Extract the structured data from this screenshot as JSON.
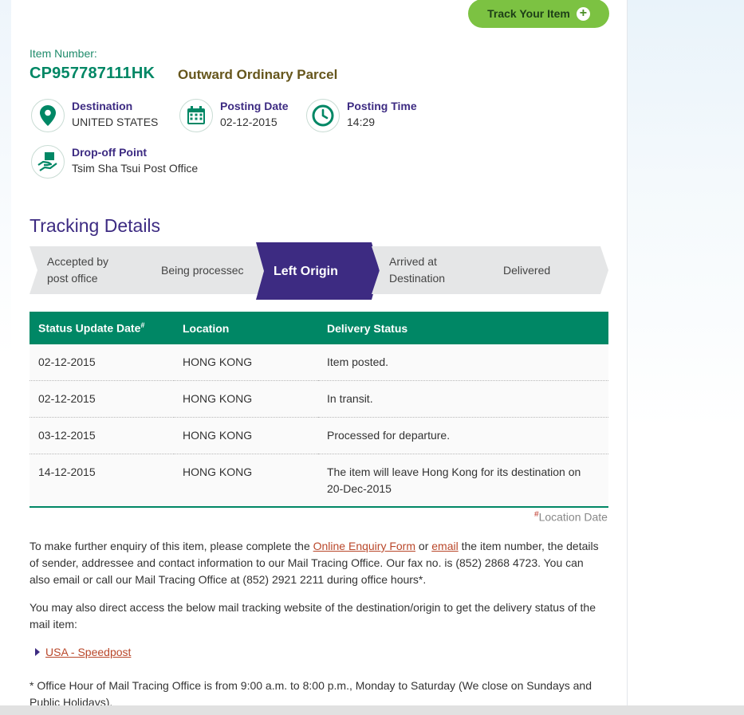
{
  "track_button": {
    "label": "Track Your Item",
    "icon": "plus-icon"
  },
  "item": {
    "number_label": "Item Number:",
    "number": "CP957787111HK",
    "type": "Outward Ordinary Parcel"
  },
  "info": {
    "destination": {
      "heading": "Destination",
      "value": "UNITED STATES",
      "icon": "location-pin-icon"
    },
    "posting_date": {
      "heading": "Posting Date",
      "value": "02-12-2015",
      "icon": "calendar-icon"
    },
    "posting_time": {
      "heading": "Posting Time",
      "value": "14:29",
      "icon": "clock-icon"
    },
    "dropoff": {
      "heading": "Drop-off Point",
      "value": "Tsim Sha Tsui Post Office",
      "icon": "handover-icon"
    }
  },
  "tracking": {
    "title": "Tracking Details",
    "steps": [
      {
        "label": "Accepted by\npost office",
        "active": false
      },
      {
        "label": "Being processec",
        "active": false
      },
      {
        "label": "Left Origin",
        "active": true
      },
      {
        "label": "Arrived at\nDestination",
        "active": false
      },
      {
        "label": "Delivered",
        "active": false
      }
    ],
    "columns": [
      "Status Update Date",
      "Location",
      "Delivery Status"
    ],
    "column_sup": "#",
    "rows": [
      [
        "02-12-2015",
        "HONG KONG",
        "Item posted."
      ],
      [
        "02-12-2015",
        "HONG KONG",
        "In transit."
      ],
      [
        "03-12-2015",
        "HONG KONG",
        "Processed for departure."
      ],
      [
        "14-12-2015",
        "HONG KONG",
        "The item will leave Hong Kong for its destination on 20-Dec-2015"
      ]
    ]
  },
  "location_date_note": {
    "sup": "#",
    "text": "Location Date"
  },
  "enquiry": {
    "pre": "To make further enquiry of this item, please complete the ",
    "link1": "Online Enquiry Form",
    "mid": " or ",
    "link2": "email",
    "post": " the item number, the details of sender, addressee and contact information to our Mail Tracing Office. Our fax no. is (852) 2868 4723. You can also email or call our Mail Tracing Office at (852) 2921 2211 during office hours*."
  },
  "direct_access": "You may also direct access the below mail tracking website of the destination/origin to get the delivery status of the mail item:",
  "external_link": "USA - Speedpost",
  "office_hours": "* Office Hour of Mail Tracing Office is from 9:00 a.m. to 8:00 p.m., Monday to Saturday (We close on Sundays and Public Holidays)."
}
